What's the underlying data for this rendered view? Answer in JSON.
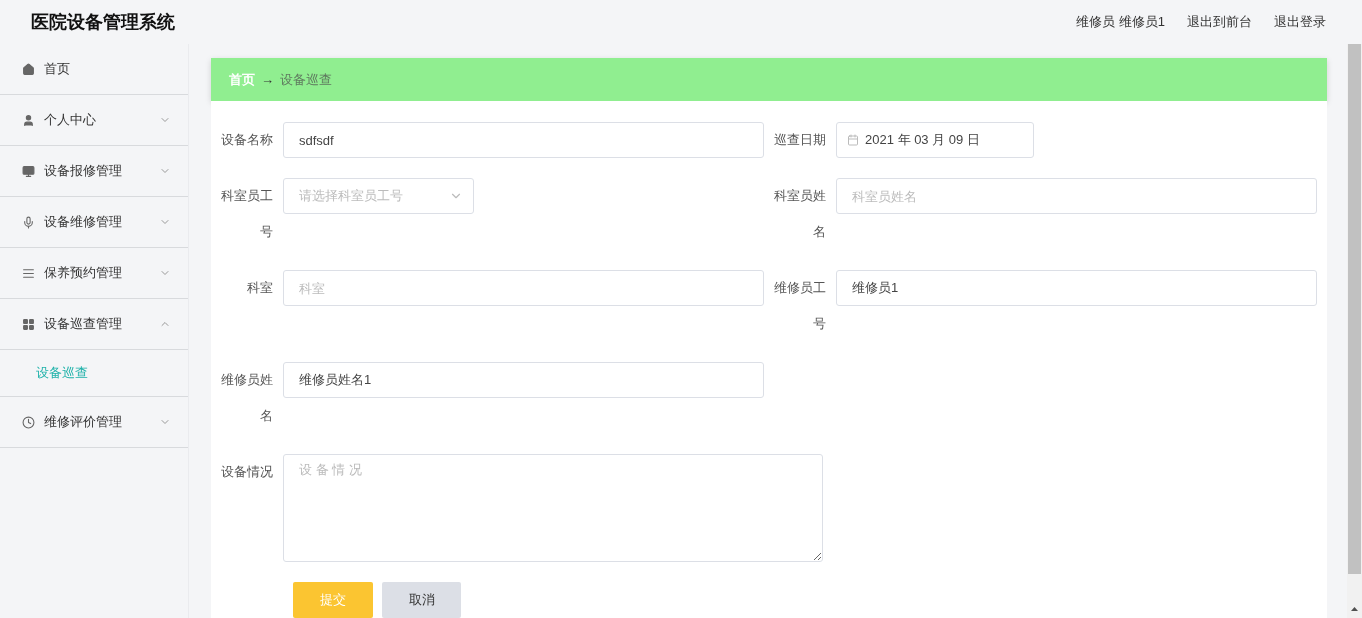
{
  "header": {
    "title": "医院设备管理系统",
    "user": "维修员 维修员1",
    "links": [
      "退出到前台",
      "退出登录"
    ]
  },
  "sidebar": {
    "items": [
      {
        "label": "首页",
        "kind": "link"
      },
      {
        "label": "个人中心",
        "kind": "menu",
        "expanded": false
      },
      {
        "label": "设备报修管理",
        "kind": "menu",
        "expanded": false
      },
      {
        "label": "设备维修管理",
        "kind": "menu",
        "expanded": false
      },
      {
        "label": "保养预约管理",
        "kind": "menu",
        "expanded": false
      },
      {
        "label": "设备巡查管理",
        "kind": "menu",
        "expanded": true,
        "children": [
          {
            "label": "设备巡查",
            "selected": true
          }
        ]
      },
      {
        "label": "维修评价管理",
        "kind": "menu",
        "expanded": false
      }
    ]
  },
  "breadcrumb": {
    "home": "首页",
    "arrow": "→",
    "current": "设备巡查"
  },
  "form": {
    "rows": [
      [
        {
          "label": "设备名称",
          "kind": "text",
          "value": "sdfsdf"
        },
        {
          "label": "巡查日期",
          "kind": "date",
          "value": "2021 年 03 月 09 日"
        }
      ],
      [
        {
          "label": "科室员工号",
          "kind": "select",
          "placeholder": "请选择科室员工号"
        },
        {
          "label": "科室员姓名",
          "kind": "text",
          "placeholder": "科室员姓名"
        }
      ],
      [
        {
          "label": "科室",
          "kind": "text",
          "placeholder": "科室"
        },
        {
          "label": "维修员工号",
          "kind": "text",
          "value": "维修员1"
        }
      ],
      [
        {
          "label": "维修员姓名",
          "kind": "text",
          "value": "维修员姓名1"
        }
      ],
      [
        {
          "label": "设备情况",
          "kind": "textarea",
          "placeholder": "设 备 情 况"
        }
      ]
    ],
    "buttons": [
      {
        "label": "提交",
        "kind": "primary"
      },
      {
        "label": "取消",
        "kind": "secondary"
      }
    ]
  }
}
